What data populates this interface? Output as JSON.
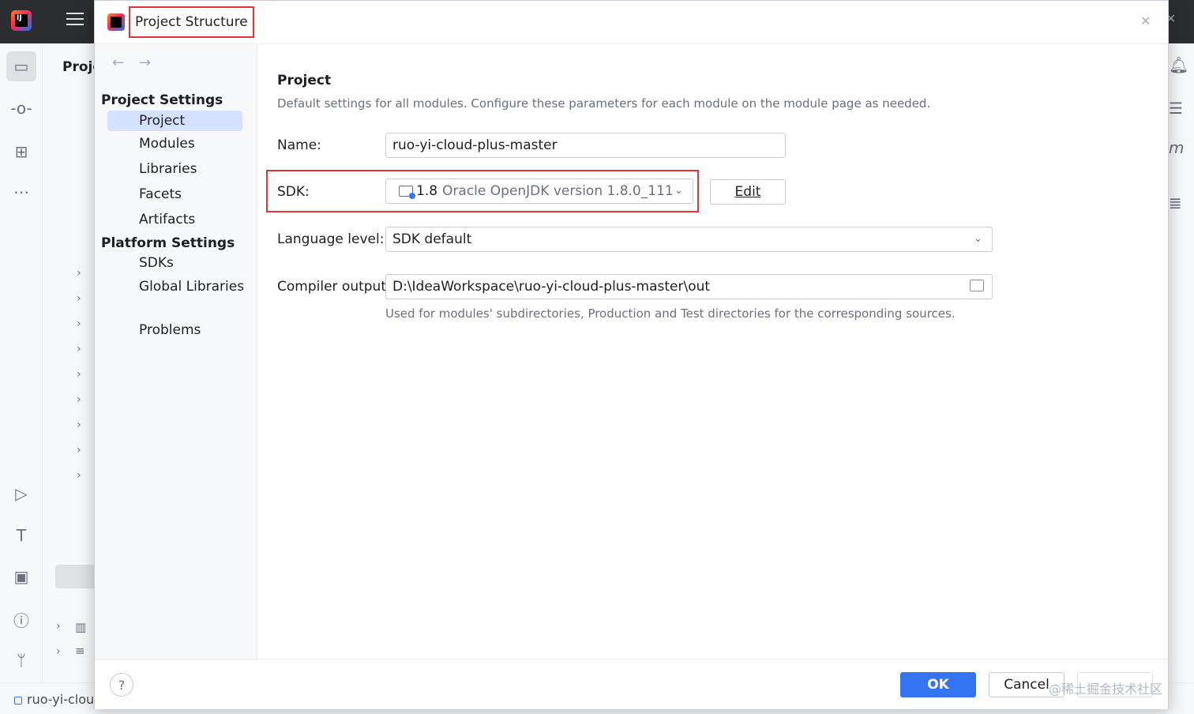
{
  "background_ide": {
    "panel_title": "Proje",
    "status_text": "ruo-yi-clou"
  },
  "dialog": {
    "title": "Project Structure",
    "sidebar": {
      "back_icon": "arrow-left-icon",
      "forward_icon": "arrow-right-icon",
      "groups": [
        {
          "label": "Project Settings",
          "items": [
            "Project",
            "Modules",
            "Libraries",
            "Facets",
            "Artifacts"
          ]
        },
        {
          "label": "Platform Settings",
          "items": [
            "SDKs",
            "Global Libraries"
          ]
        }
      ],
      "problems": "Problems",
      "selected": "Project"
    },
    "content": {
      "heading": "Project",
      "description": "Default settings for all modules. Configure these parameters for each module on the module page as needed.",
      "name_label": "Name:",
      "name_value": "ruo-yi-cloud-plus-master",
      "sdk_label": "SDK:",
      "sdk_version": "1.8",
      "sdk_description": "Oracle OpenJDK version 1.8.0_111",
      "edit_button": "Edit",
      "language_label": "Language level:",
      "language_value": "SDK default",
      "compiler_label": "Compiler output:",
      "compiler_value": "D:\\IdeaWorkspace\\ruo-yi-cloud-plus-master\\out",
      "compiler_hint": "Used for modules' subdirectories, Production and Test directories for the corresponding sources."
    },
    "footer": {
      "help": "?",
      "ok": "OK",
      "cancel": "Cancel",
      "watermark": "@稀土掘金技术社区"
    }
  },
  "colors": {
    "accent": "#3574f0",
    "highlight_border": "#e8323a",
    "selection": "#d5e1ff"
  }
}
